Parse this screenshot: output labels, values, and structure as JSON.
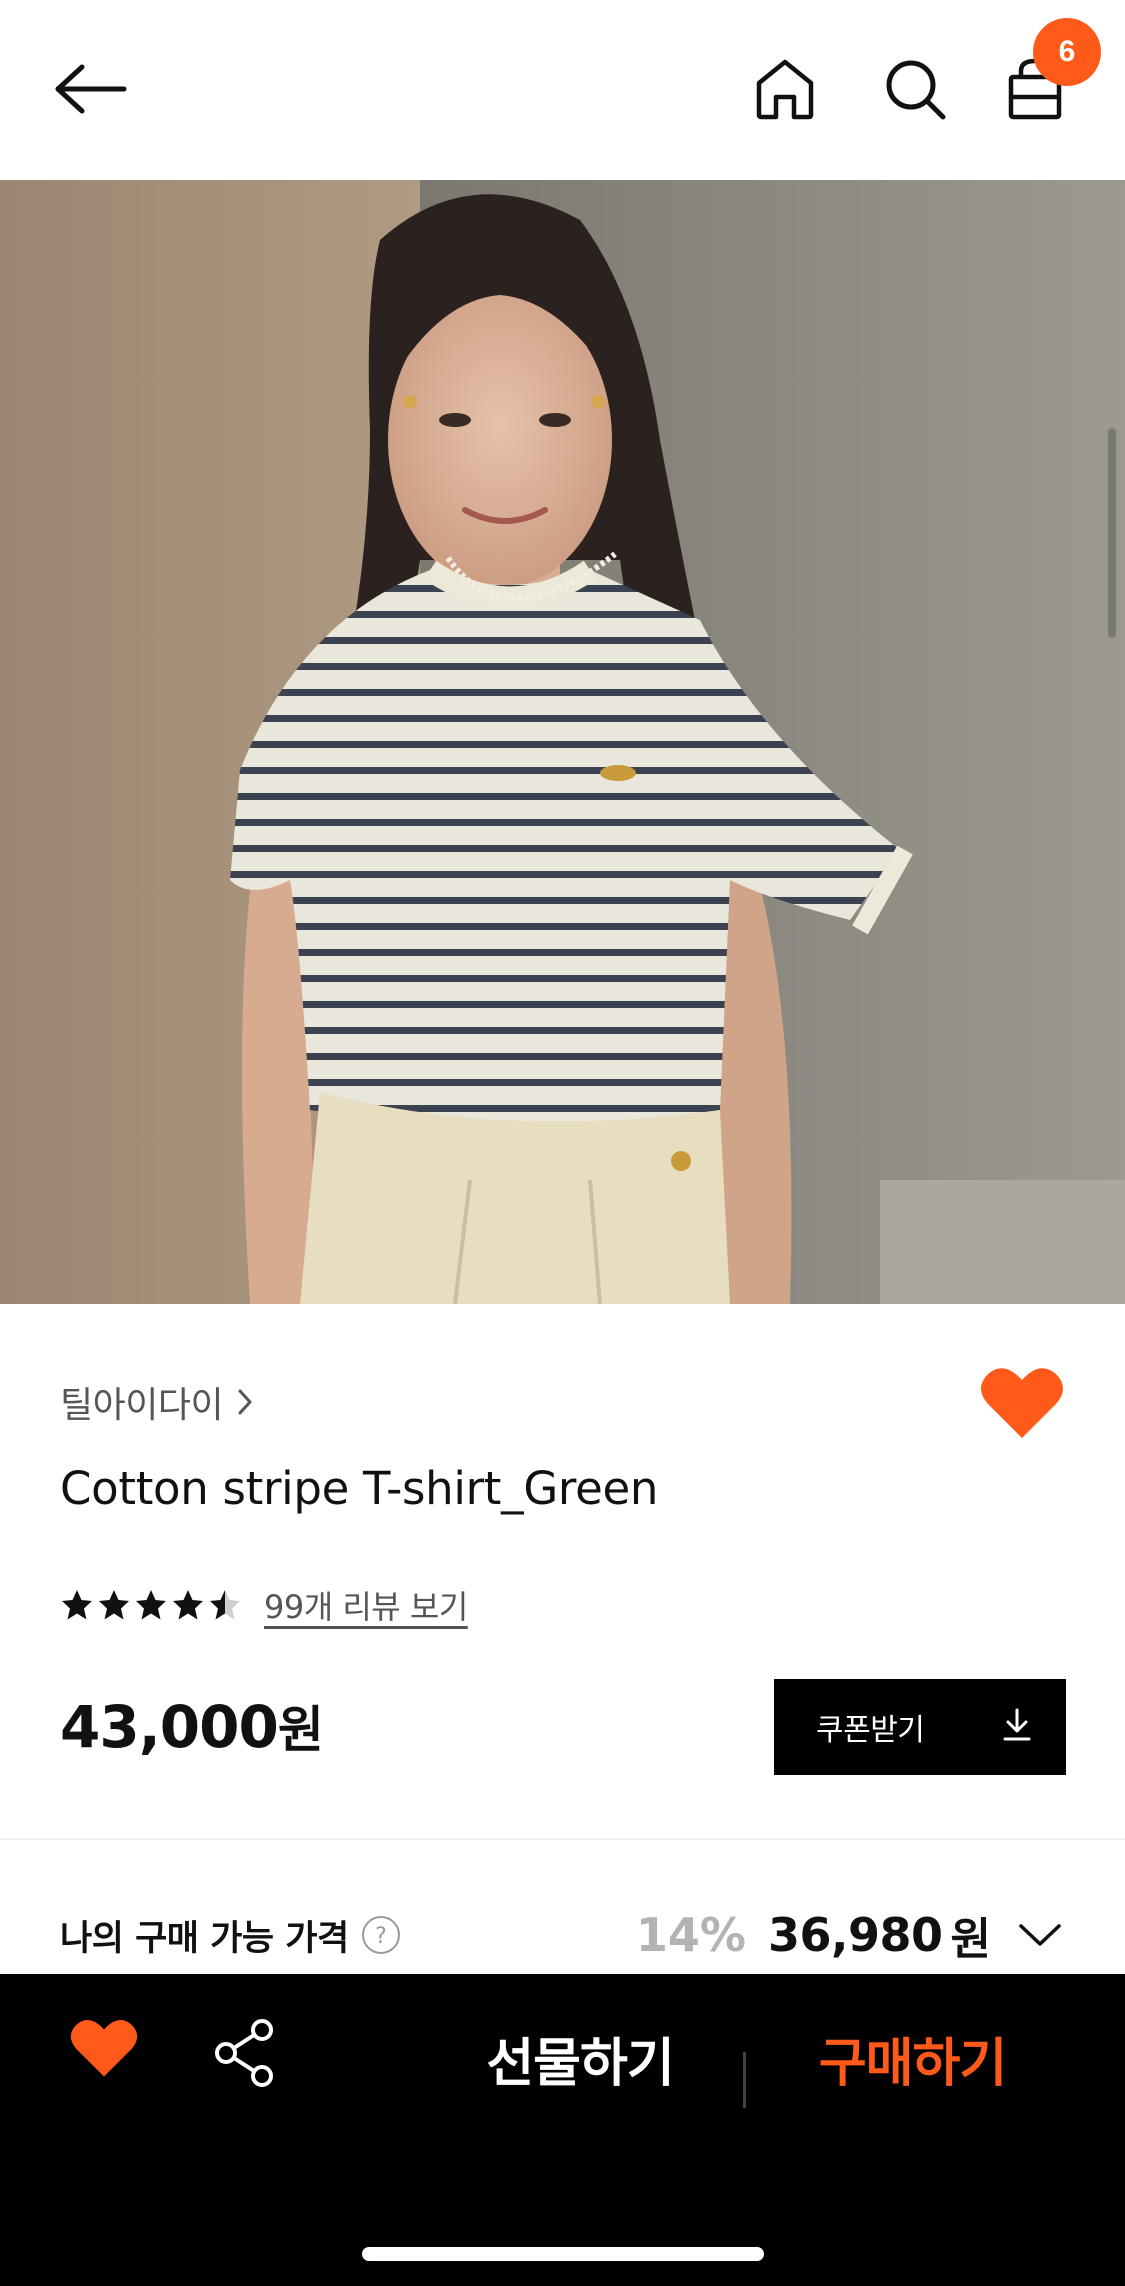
{
  "header": {
    "back_icon": "arrow-left-icon",
    "home_icon": "home-icon",
    "search_icon": "search-icon",
    "cart_icon": "shopping-bag-icon",
    "cart_count": "6"
  },
  "product": {
    "image": "model-wearing-striped-tshirt",
    "brand": "틸아이다이",
    "title": "Cotton stripe T-shirt_Green",
    "rating": 4.5,
    "rating_max": 5,
    "review_link": "99개 리뷰 보기",
    "price": "43,000",
    "price_unit": "원",
    "wishlisted": true
  },
  "coupon": {
    "label": "쿠폰받기",
    "icon": "download-icon"
  },
  "available_price": {
    "label": "나의 구매 가능 가격",
    "discount": "14%",
    "price": "36,980",
    "unit": "원"
  },
  "bottom_bar": {
    "gift_label": "선물하기",
    "buy_label": "구매하기",
    "wish_icon": "heart-icon",
    "share_icon": "share-icon"
  },
  "colors": {
    "accent": "#ff5a1a",
    "dark": "#000000",
    "muted": "#b3b3b3"
  }
}
